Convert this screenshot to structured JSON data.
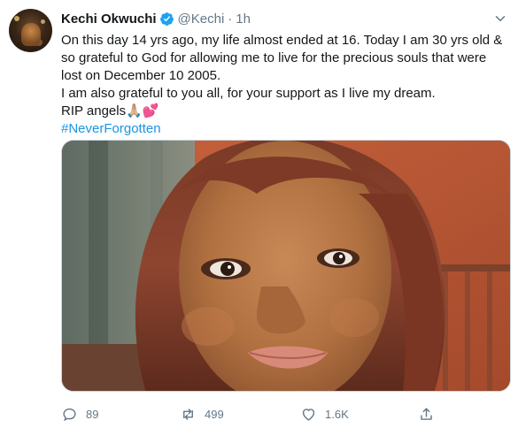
{
  "tweet": {
    "author": {
      "display_name": "Kechi Okwuchi",
      "handle": "@Kechi",
      "verified": true
    },
    "separator": "·",
    "timestamp": "1h",
    "text_lines": [
      "On this day 14 yrs ago, my life almost ended at 16. Today I am 30 yrs old &",
      "so grateful to God for allowing me to live for the precious souls that were",
      "lost on December 10 2005.",
      "I am also grateful to you all, for your support as I live my dream.",
      "RIP angels🙏🏼💕"
    ],
    "hashtag": "#NeverForgotten",
    "media_icon": "photo",
    "actions": {
      "reply_count": "89",
      "retweet_count": "499",
      "like_count": "1.6K"
    }
  },
  "colors": {
    "link": "#1b95e0",
    "verified_badge": "#1da1f2",
    "secondary_text": "#657786"
  },
  "icons": [
    "verified-badge-icon",
    "chevron-down-icon",
    "reply-icon",
    "retweet-icon",
    "like-icon",
    "share-icon"
  ]
}
